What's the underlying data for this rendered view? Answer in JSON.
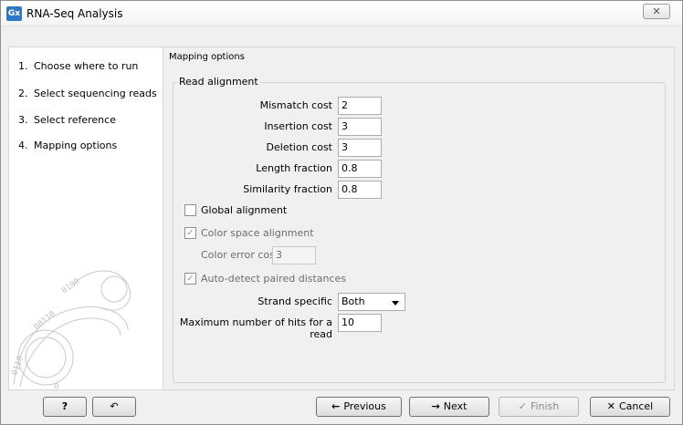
{
  "window": {
    "app_icon_text": "Gx",
    "title": "RNA-Seq Analysis",
    "close_label": "✕"
  },
  "steps": [
    {
      "num": "1.",
      "label": "Choose where to run"
    },
    {
      "num": "2.",
      "label": "Select sequencing reads"
    },
    {
      "num": "3.",
      "label": "Select reference"
    },
    {
      "num": "4.",
      "label": "Mapping options"
    }
  ],
  "main": {
    "section_title": "Mapping options",
    "group_title": "Read alignment",
    "fields": {
      "mismatch_label": "Mismatch cost",
      "mismatch_value": "2",
      "insertion_label": "Insertion cost",
      "insertion_value": "3",
      "deletion_label": "Deletion cost",
      "deletion_value": "3",
      "length_label": "Length fraction",
      "length_value": "0.8",
      "similarity_label": "Similarity fraction",
      "similarity_value": "0.8"
    },
    "global_alignment_label": "Global alignment",
    "color_space_label": "Color space alignment",
    "color_error_label": "Color error cost",
    "color_error_value": "3",
    "auto_detect_label": "Auto-detect paired distances",
    "strand_label": "Strand specific",
    "strand_value": "Both",
    "max_hits_label": "Maximum number of hits for a read",
    "max_hits_value": "10"
  },
  "footer": {
    "help_label": "?",
    "previous_label": "Previous",
    "next_label": "Next",
    "finish_label": "Finish",
    "cancel_label": "Cancel"
  }
}
